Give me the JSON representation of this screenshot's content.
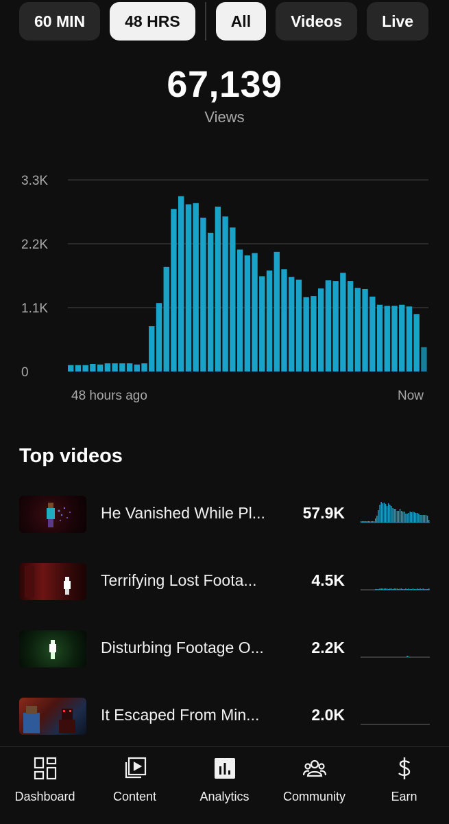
{
  "filters": {
    "time": [
      {
        "label": "60 MIN",
        "active": false
      },
      {
        "label": "48 HRS",
        "active": true
      }
    ],
    "type": [
      {
        "label": "All",
        "active": true
      },
      {
        "label": "Videos",
        "active": false
      },
      {
        "label": "Live",
        "active": false
      }
    ]
  },
  "summary": {
    "total": "67,139",
    "label": "Views"
  },
  "colors": {
    "accent": "#1aa3c9",
    "accent_dim": "#167f9c",
    "background": "#0f0f0f",
    "chip": "#272727"
  },
  "chart_data": {
    "type": "bar",
    "y_ticks": [
      "0",
      "1.1K",
      "2.2K",
      "3.3K"
    ],
    "ylim": [
      0,
      3300
    ],
    "x_start_label": "48 hours ago",
    "x_end_label": "Now",
    "grid": true,
    "values": [
      110,
      110,
      110,
      130,
      120,
      140,
      140,
      140,
      140,
      120,
      140,
      780,
      1180,
      1800,
      2800,
      3020,
      2880,
      2900,
      2650,
      2390,
      2840,
      2670,
      2480,
      2100,
      2000,
      2040,
      1640,
      1740,
      2060,
      1760,
      1630,
      1580,
      1280,
      1300,
      1430,
      1570,
      1560,
      1700,
      1560,
      1440,
      1420,
      1290,
      1150,
      1130,
      1130,
      1150,
      1120,
      990,
      420
    ],
    "last_partial": true
  },
  "top_videos": {
    "title": "Top videos",
    "items": [
      {
        "title": "He Vanished While Pl...",
        "views": "57.9K",
        "thumb": "cyan-figure",
        "spark": [
          2,
          2,
          2,
          2,
          2,
          2,
          2,
          2,
          2,
          2,
          6,
          10,
          18,
          26,
          30,
          28,
          29,
          27,
          24,
          28,
          26,
          24,
          21,
          20,
          20,
          17,
          17,
          20,
          17,
          16,
          16,
          13,
          13,
          14,
          16,
          15,
          16,
          15,
          14,
          14,
          13,
          11,
          11,
          11,
          11,
          11,
          10,
          4
        ]
      },
      {
        "title": "Terrifying Lost Foota...",
        "views": "4.5K",
        "thumb": "red-figure",
        "spark": [
          0,
          0,
          0,
          0,
          0,
          0,
          0,
          0,
          0,
          0,
          1,
          1,
          1,
          2,
          2,
          2,
          2,
          2,
          2,
          1,
          2,
          2,
          1,
          2,
          2,
          2,
          1,
          2,
          2,
          1,
          1,
          2,
          1,
          2,
          1,
          1,
          2,
          1,
          1,
          2,
          1,
          2,
          1,
          2,
          1,
          1,
          1,
          2
        ]
      },
      {
        "title": "Disturbing Footage O...",
        "views": "2.2K",
        "thumb": "green-figure",
        "spark": [
          0,
          0,
          0,
          0,
          0,
          0,
          0,
          0,
          0,
          0,
          0,
          0,
          0,
          0,
          0,
          0,
          0,
          0,
          0,
          0,
          0,
          0,
          0,
          0,
          0,
          0,
          0,
          0,
          0,
          0,
          0,
          0,
          2,
          1,
          0,
          0,
          0,
          0,
          0,
          0,
          0,
          0,
          0,
          0,
          0,
          0,
          0,
          0
        ]
      },
      {
        "title": "It Escaped From Min...",
        "views": "2.0K",
        "thumb": "orange-figure",
        "spark": [
          0,
          0,
          0,
          0,
          0,
          0,
          0,
          0,
          0,
          0,
          0,
          0,
          0,
          0,
          0,
          0,
          0,
          0,
          0,
          0,
          0,
          0,
          0,
          0,
          0,
          0,
          0,
          0,
          0,
          0,
          0,
          0,
          0,
          0,
          0,
          0,
          0,
          0,
          0,
          0,
          0,
          0,
          0,
          0,
          0,
          0,
          0,
          0
        ]
      }
    ]
  },
  "nav": [
    {
      "label": "Dashboard",
      "icon": "dashboard-icon"
    },
    {
      "label": "Content",
      "icon": "content-icon"
    },
    {
      "label": "Analytics",
      "icon": "analytics-icon"
    },
    {
      "label": "Community",
      "icon": "community-icon"
    },
    {
      "label": "Earn",
      "icon": "earn-icon"
    }
  ]
}
